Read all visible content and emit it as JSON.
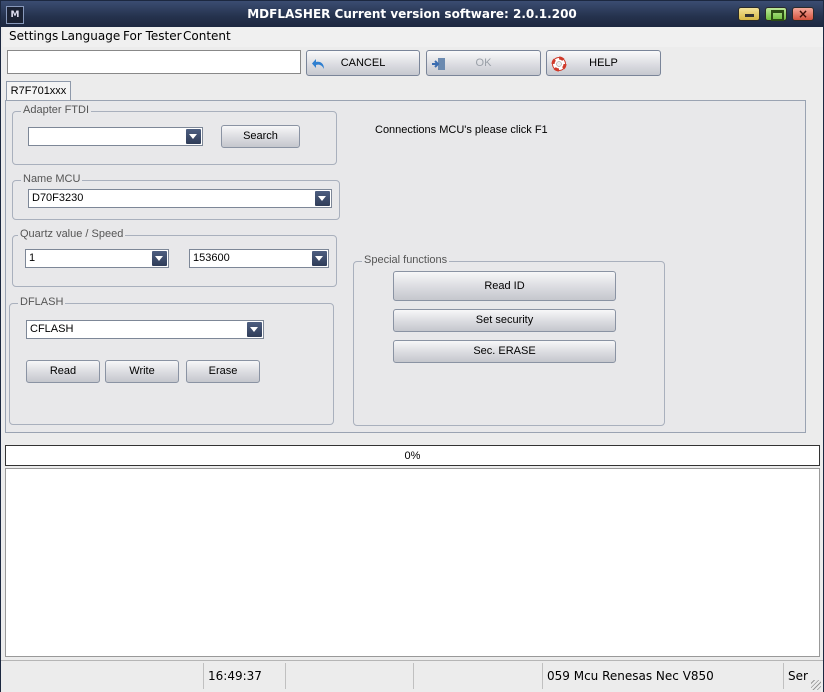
{
  "window": {
    "title": "MDFLASHER  Current version software: 2.0.1.200",
    "app_icon_text": "M"
  },
  "menu": [
    "Settings",
    "Language",
    "For Tester",
    "Content"
  ],
  "toolbar": {
    "input_value": "",
    "buttons": [
      {
        "label": "CANCEL",
        "icon": "undo-arrow-icon",
        "enabled": true
      },
      {
        "label": "OK",
        "icon": "exit-door-icon",
        "enabled": false
      },
      {
        "label": "HELP",
        "icon": "lifebuoy-icon",
        "enabled": true
      }
    ]
  },
  "tab": {
    "label": "R7F701xxx"
  },
  "adapter": {
    "legend": "Adapter FTDI",
    "value": "",
    "search_label": "Search"
  },
  "mcu": {
    "legend": "Name MCU",
    "value": "D70F3230"
  },
  "quartz": {
    "legend": "Quartz value / Speed",
    "quartz_value": "1",
    "speed_value": "153600"
  },
  "dflash": {
    "legend": "DFLASH",
    "value": "CFLASH",
    "read_label": "Read",
    "write_label": "Write",
    "erase_label": "Erase"
  },
  "note": "Connections MCU's please click F1",
  "special": {
    "legend": "Special functions",
    "read_id_label": "Read ID",
    "set_security_label": "Set security",
    "sec_erase_label": "Sec. ERASE"
  },
  "progress": {
    "text": "0%",
    "value": 0
  },
  "status": {
    "time": "16:49:37",
    "device": "059 Mcu Renesas Nec V850",
    "port": "Ser"
  },
  "colors": {
    "title_bg": "#25324d",
    "combo_arrow": "#3a4866"
  }
}
